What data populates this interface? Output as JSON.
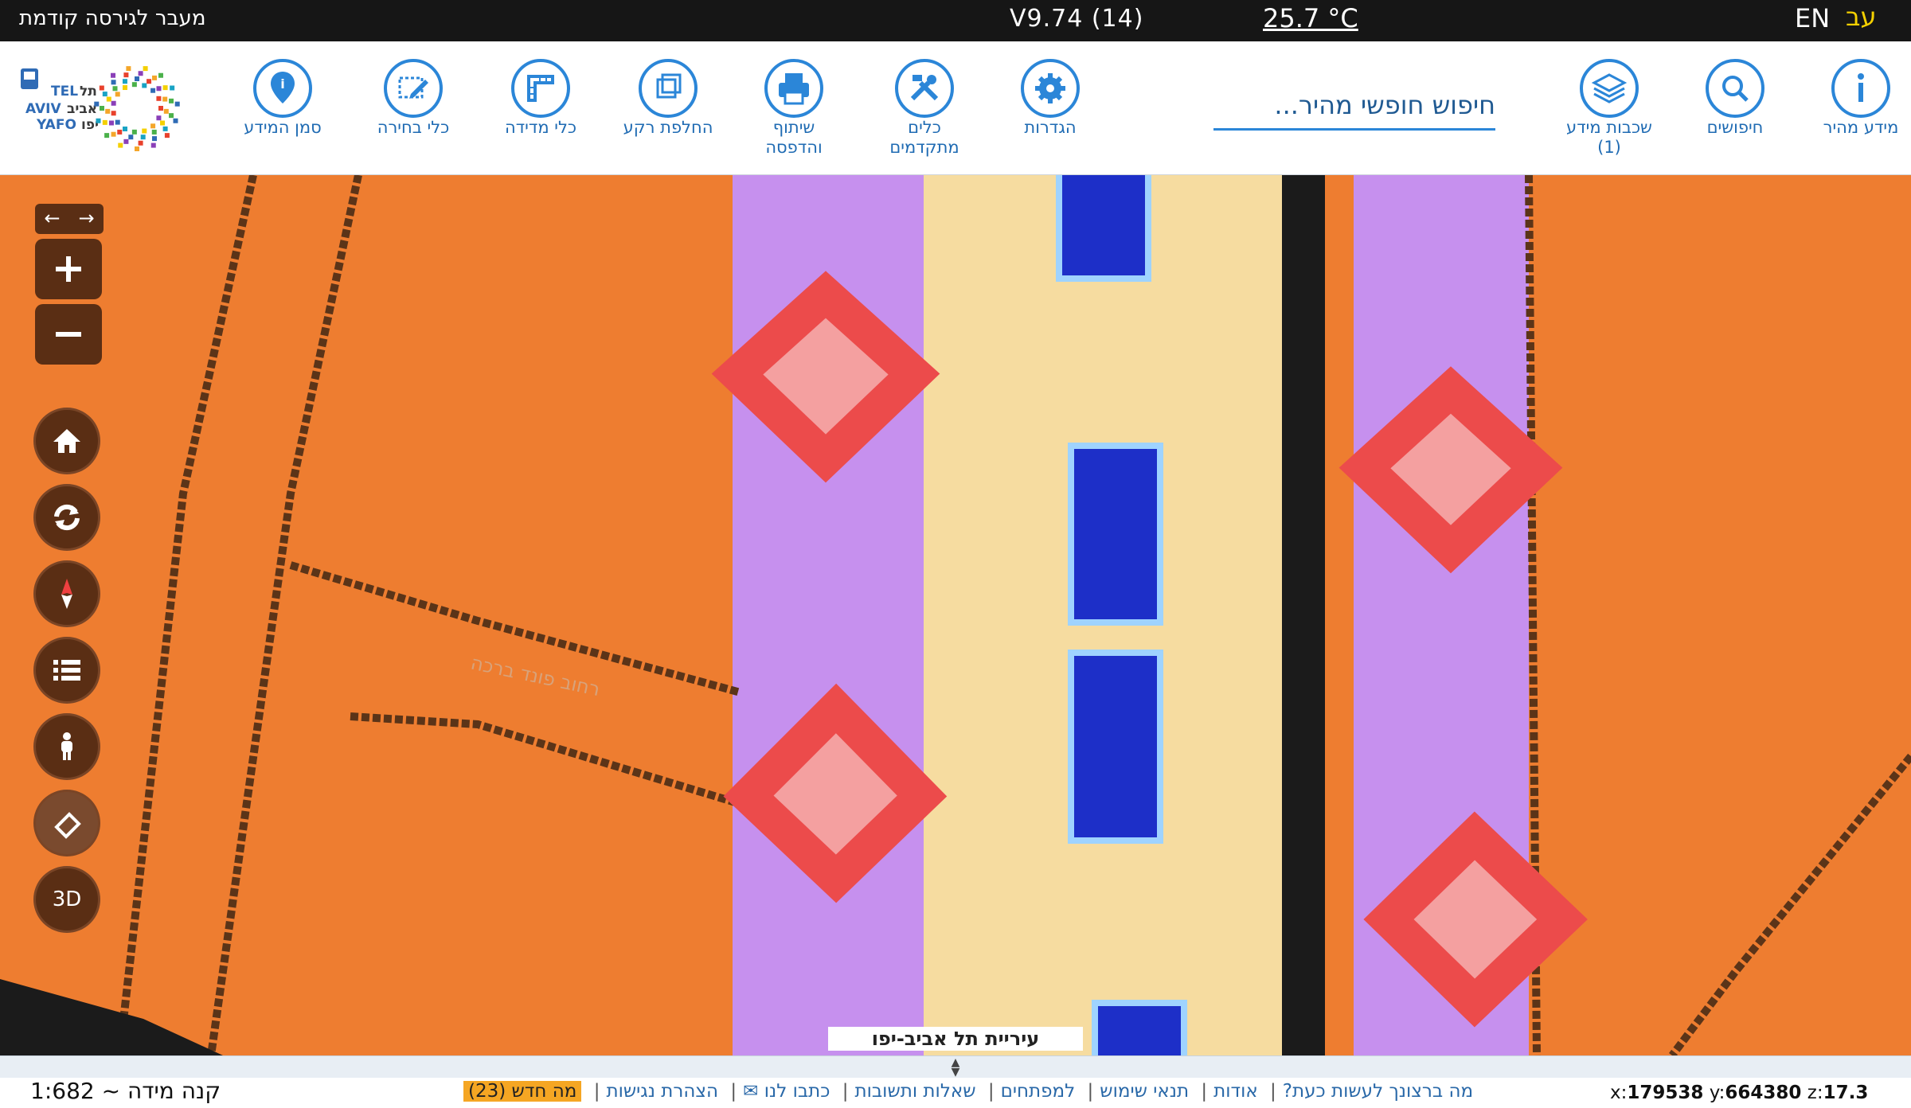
{
  "topbar": {
    "prev_version": "מעבר לגירסה קודמת",
    "version": "V9.74 (14)",
    "temperature": "25.7 °C",
    "lang_en": "EN",
    "lang_he": "עב"
  },
  "toolbar": {
    "logo_text_en": "TEL AVIV YAFO",
    "logo_text_he": "תל אביב יפו",
    "tools": [
      {
        "label": "סמן המידע",
        "icon": "map-pin-icon"
      },
      {
        "label": "כלי בחירה",
        "icon": "select-tool-icon"
      },
      {
        "label": "כלי מדידה",
        "icon": "ruler-icon"
      },
      {
        "label": "החלפת רקע",
        "icon": "layers-swap-icon"
      },
      {
        "label": "שיתוף\nוהדפסה",
        "icon": "printer-icon"
      },
      {
        "label": "כלים\nמתקדמים",
        "icon": "tools-icon"
      },
      {
        "label": "הגדרות",
        "icon": "gear-icon"
      },
      {
        "label": "שכבות מידע\n(1)",
        "icon": "stack-icon"
      },
      {
        "label": "חיפושים",
        "icon": "search-icon"
      },
      {
        "label": "מידע מהיר",
        "icon": "info-icon"
      }
    ],
    "search_placeholder": "חיפוש חופשי מהיר..."
  },
  "map": {
    "street_label": "רחוב פונד ברכה",
    "street_label_2": "ברכה",
    "city_label": "עיריית תל אביב-יפו",
    "controls": [
      "history-back",
      "history-forward",
      "zoom-in",
      "zoom-out",
      "home",
      "refresh",
      "compass",
      "legend",
      "street-view",
      "eraser",
      "3d"
    ],
    "three_d_label": "3D",
    "colors": {
      "landuse": "#ee7d30",
      "purple": "#c690ee",
      "road": "#f6dca0",
      "building": "#1d2fc8",
      "marker": "#ef5a5a"
    }
  },
  "footer": {
    "scale": "קנה מידה ~ 1:682",
    "links": [
      "מה ברצונך לעשות כעת?",
      "אודות",
      "תנאי שימוש",
      "למפתחים",
      "שאלות ותשובות",
      "כתבו לנו ✉",
      "הצהרת נגישות"
    ],
    "whats_new": "מה חדש (23)",
    "coords": {
      "x_label": "x:",
      "x": "179538",
      "y_label": "y:",
      "y": "664380",
      "z_label": "z:",
      "z": "17.3"
    }
  }
}
